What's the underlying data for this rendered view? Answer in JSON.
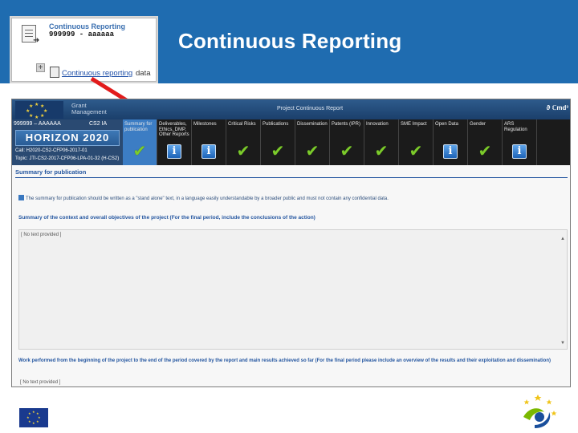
{
  "slide": {
    "title": "Continuous Reporting"
  },
  "snippet": {
    "title": "Continuous Reporting",
    "subtitle": "999999 - aaaaaa",
    "link": "Continuous reporting",
    "data_label": "data"
  },
  "app": {
    "brand_label": "Grant\nManagement",
    "header_title": "Project Continuous Report",
    "logo_text": "ϑ ℂmd³",
    "project_number": "999999 – AAAAAA",
    "project_acronym": "CS2 IA",
    "program": "HORIZON 2020",
    "call": "Call: H2020-CS2-CFP06-2017-01",
    "topic": "Topic: JTI-CS2-2017-CFP06-LPA-01-32 (H-CS2)"
  },
  "tabs": [
    {
      "label": "Summary for publication",
      "icon": "check-icon",
      "active": true
    },
    {
      "label": "Deliverables, Ethics, DMP, Other Reports",
      "icon": "info-icon",
      "active": false
    },
    {
      "label": "Milestones",
      "icon": "info-icon",
      "active": false
    },
    {
      "label": "Critical Risks",
      "icon": "check-icon",
      "active": false
    },
    {
      "label": "Publications",
      "icon": "check-icon",
      "active": false
    },
    {
      "label": "Dissemination",
      "icon": "check-icon",
      "active": false
    },
    {
      "label": "Patents (IPR)",
      "icon": "check-icon",
      "active": false
    },
    {
      "label": "Innovation",
      "icon": "check-icon",
      "active": false
    },
    {
      "label": "SME Impact",
      "icon": "check-icon",
      "active": false
    },
    {
      "label": "Open Data",
      "icon": "info-icon",
      "active": false
    },
    {
      "label": "Gender",
      "icon": "check-icon",
      "active": false
    },
    {
      "label": "ARS Regulation",
      "icon": "info-icon",
      "active": false
    }
  ],
  "content": {
    "section_title": "Summary for publication",
    "help_text": "The summary for publication should be written as a \"stand alone\" text, in a language easily understandable by a broader public and must not contain any confidential data.",
    "question1": "Summary of the context and overall objectives of the project (For the final period, include the conclusions of the action)",
    "placeholder1": "[ No text provided ]",
    "question2": "Work performed from the beginning of the project to the end of the period covered by the report and main results achieved so far (For the final period please include an overview of the results and their exploitation and dissemination)",
    "placeholder2": "[ No text provided ]"
  },
  "colors": {
    "banner": "#1f6cb0",
    "active_tab": "#3c7dc4",
    "check": "#7ccb2b",
    "arrow": "#e21b1b"
  }
}
